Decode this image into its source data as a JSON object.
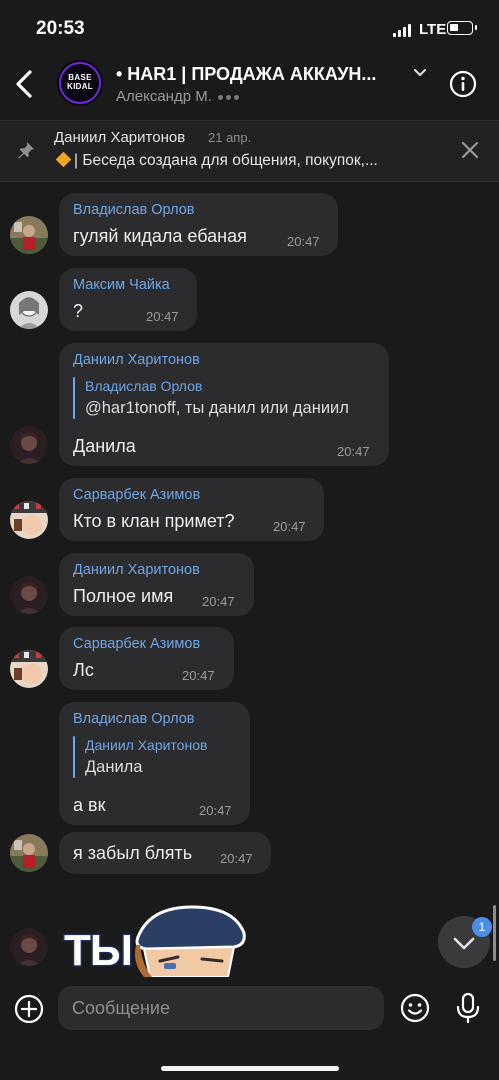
{
  "status_bar": {
    "time": "20:53",
    "network": "LTE",
    "battery_level": 0.3
  },
  "header": {
    "title": "• HAR1 | ПРОДАЖА АККАУН...",
    "subtitle": "Александр М.",
    "avatar_text_line1": "BASE",
    "avatar_text_line2": "KIDAL",
    "icons": {
      "back": "chevron-left-icon",
      "expand": "chevron-down-icon",
      "info": "info-icon"
    }
  },
  "pinned": {
    "author": "Даниил Харитонов",
    "date": "21 апр.",
    "text": "| Беседа создана для общения, покупок,...",
    "icons": {
      "pin": "pin-icon",
      "close": "close-icon"
    }
  },
  "messages": [
    {
      "author": "Владислав Орлов",
      "text": "гуляй кидала ебаная",
      "time": "20:47"
    },
    {
      "author": "Максим Чайка",
      "text": "?",
      "time": "20:47"
    },
    {
      "author": "Даниил Харитонов",
      "reply_author": "Владислав Орлов",
      "reply_text": "@har1tonoff, ты данил или даниил",
      "text": "Данила",
      "time": "20:47"
    },
    {
      "author": "Сарварбек Азимов",
      "text": "Кто в клан примет?",
      "time": "20:47"
    },
    {
      "author": "Даниил Харитонов",
      "text": "Полное имя",
      "time": "20:47"
    },
    {
      "author": "Сарварбек Азимов",
      "text": "Лс",
      "time": "20:47"
    },
    {
      "author": "Владислав Орлов",
      "reply_author": "Даниил Харитонов",
      "reply_text": "Данила",
      "text": "а вк",
      "time": "20:47"
    },
    {
      "author": "",
      "text": "я забыл блять",
      "time": "20:47"
    }
  ],
  "sticker": {
    "text": "ТЫ"
  },
  "scroll": {
    "unread_count": "1"
  },
  "composer": {
    "placeholder": "Сообщение",
    "icons": {
      "attach": "plus-circle-icon",
      "emoji": "emoji-icon",
      "voice": "microphone-icon"
    }
  },
  "colors": {
    "background": "#1a1a1a",
    "bubble": "#2c2c2e",
    "name": "#6fa6e6",
    "accent": "#4a8ee5"
  }
}
